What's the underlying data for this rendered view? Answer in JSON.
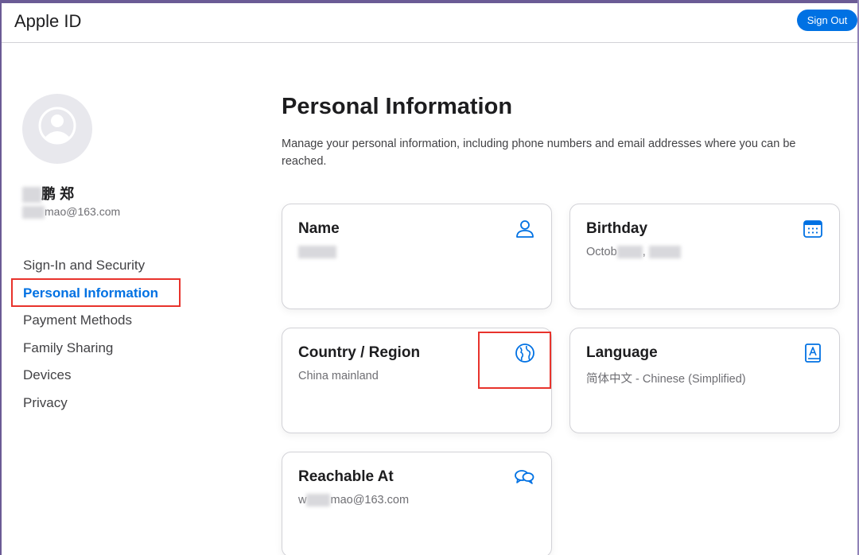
{
  "app": {
    "title": "Apple ID",
    "signout_label": "Sign Out"
  },
  "profile": {
    "name_suffix": "鹏 郑",
    "email_suffix": "mao@163.com"
  },
  "sidebar": {
    "items": [
      {
        "label": "Sign-In and Security"
      },
      {
        "label": "Personal Information",
        "active": true
      },
      {
        "label": "Payment Methods"
      },
      {
        "label": "Family Sharing"
      },
      {
        "label": "Devices"
      },
      {
        "label": "Privacy"
      }
    ]
  },
  "main": {
    "title": "Personal Information",
    "description": "Manage your personal information, including phone numbers and email addresses where you can be reached.",
    "cards": {
      "name": {
        "title": "Name",
        "icon": "person-icon"
      },
      "birthday": {
        "title": "Birthday",
        "value_prefix": "Octob",
        "separator": ",",
        "icon": "calendar-icon"
      },
      "country": {
        "title": "Country / Region",
        "value": "China mainland",
        "icon": "globe-icon"
      },
      "language": {
        "title": "Language",
        "value": "简体中文 - Chinese (Simplified)",
        "icon": "book-icon"
      },
      "reachable": {
        "title": "Reachable At",
        "value_prefix": "w",
        "value_suffix": "mao@163.com",
        "icon": "chat-bubbles-icon"
      }
    }
  },
  "colors": {
    "accent": "#0071e3",
    "highlight": "#e8332c",
    "frame": "#6b5b95"
  }
}
